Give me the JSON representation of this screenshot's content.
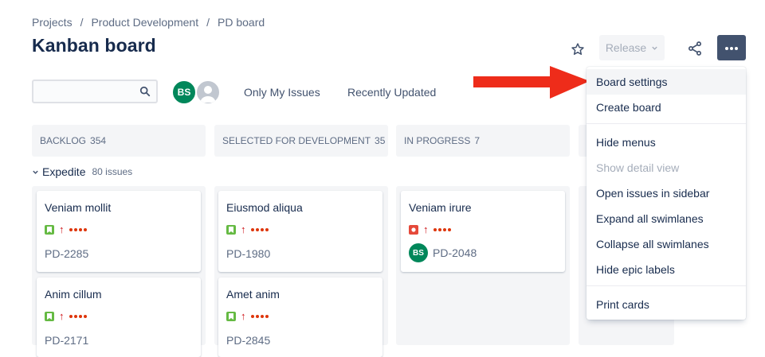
{
  "breadcrumb": [
    "Projects",
    "Product Development",
    "PD board"
  ],
  "title": "Kanban board",
  "header": {
    "release_label": "Release"
  },
  "toolbar": {
    "search_value": "",
    "avatar_initials": "BS",
    "filters": [
      "Only My Issues",
      "Recently Updated"
    ]
  },
  "columns": [
    {
      "name": "BACKLOG",
      "count": "354"
    },
    {
      "name": "SELECTED FOR DEVELOPMENT",
      "count": "35"
    },
    {
      "name": "IN PROGRESS",
      "count": "7"
    }
  ],
  "swimlane": {
    "name": "Expedite",
    "count": "80 issues"
  },
  "cards": [
    {
      "summary": "Veniam mollit",
      "key": "PD-2285",
      "type": "story"
    },
    {
      "summary": "Anim cillum",
      "key": "PD-2171",
      "type": "story"
    },
    {
      "summary": "Eiusmod aliqua",
      "key": "PD-1980",
      "type": "story"
    },
    {
      "summary": "Amet anim",
      "key": "PD-2845",
      "type": "story"
    },
    {
      "summary": "Veniam irure",
      "key": "PD-2048",
      "type": "bug",
      "assignee": "BS"
    }
  ],
  "menu": {
    "items": [
      "Board settings",
      "Create board",
      "Hide menus",
      "Show detail view",
      "Open issues in sidebar",
      "Expand all swimlanes",
      "Collapse all swimlanes",
      "Hide epic labels",
      "Print cards"
    ]
  },
  "colors": {
    "accent_button": "#42526e",
    "story": "#65ba43",
    "bug": "#e5493a",
    "priority_highest": "#cd1317",
    "avatar": "#00875a",
    "pointer_arrow": "#ee2c1a"
  }
}
